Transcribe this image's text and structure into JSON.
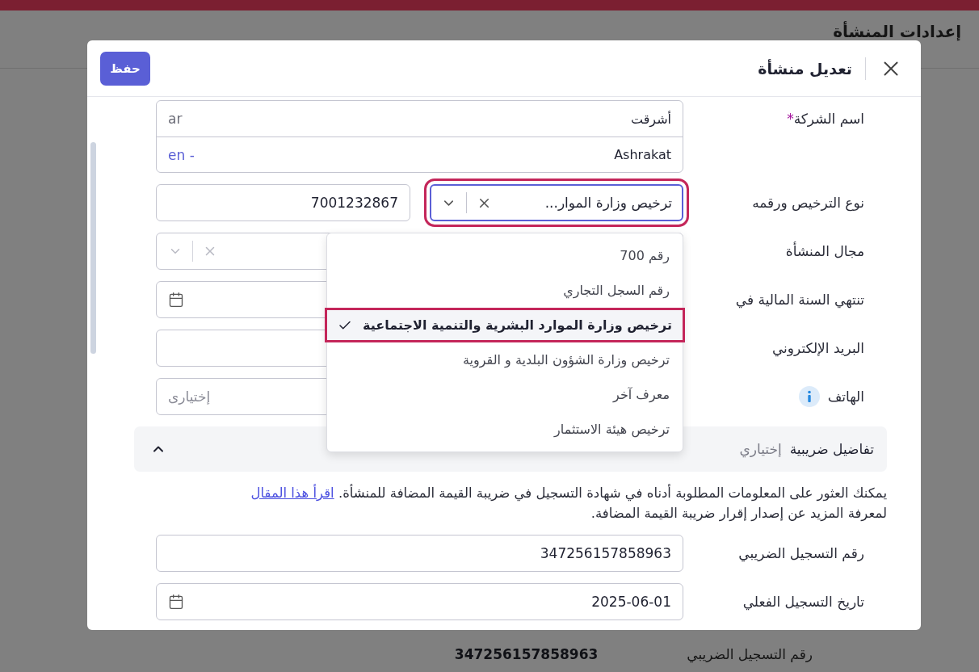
{
  "page": {
    "title": "إعدادات المنشأة",
    "background_row": {
      "label": "رقم التسجيل الضريبي",
      "value": "347256157858963"
    }
  },
  "modal": {
    "title": "تعديل منشأة",
    "save_button": "حفظ",
    "company_name": {
      "label": "اسم الشركة",
      "required_mark": "*",
      "ar": {
        "lang": "ar",
        "value": "أشرقت"
      },
      "en": {
        "lang": "en -",
        "value": "Ashrakat"
      }
    },
    "license": {
      "label": "نوع الترخيص ورقمه",
      "type_value": "ترخيص وزارة الموار...",
      "number": "7001232867",
      "open": true,
      "options": [
        {
          "label": "رقم 700",
          "selected": false
        },
        {
          "label": "رقم السجل التجاري",
          "selected": false
        },
        {
          "label": "ترخيص وزارة الموارد البشرية والتنمية الاجتماعية",
          "selected": true
        },
        {
          "label": "ترخيص وزارة الشؤون البلدية و القروية",
          "selected": false
        },
        {
          "label": "معرف آخر",
          "selected": false
        },
        {
          "label": "ترخيص هيئة الاستثمار",
          "selected": false
        }
      ]
    },
    "fields": [
      {
        "kind": "select",
        "label": "مجال المنشأة",
        "info": false
      },
      {
        "kind": "date",
        "label": "تنتهي السنة المالية في",
        "info": false
      },
      {
        "kind": "text",
        "label": "البريد الإلكتروني",
        "info": false
      },
      {
        "kind": "text",
        "label": "الهاتف",
        "placeholder": "إختيارى",
        "info": true
      }
    ],
    "tax_section": {
      "title": "تفاضيل ضريبية",
      "optional": "إختياري",
      "expanded": true,
      "note": "يمكنك العثور على المعلومات المطلوبة أدناه في شهادة التسجيل في ضريبة القيمة المضافة للمنشأة.",
      "link": "اقرأ هذا المقال",
      "note_end": "لمعرفة المزيد عن إصدار إقرار ضريبة القيمة المضافة.",
      "fields": [
        {
          "kind": "text",
          "label": "رقم التسجيل الضريبي",
          "value": "347256157858963",
          "info": false
        },
        {
          "kind": "date",
          "label": "تاريخ التسجيل الفعلي",
          "value": "2025-06-01",
          "info": false
        }
      ]
    }
  }
}
